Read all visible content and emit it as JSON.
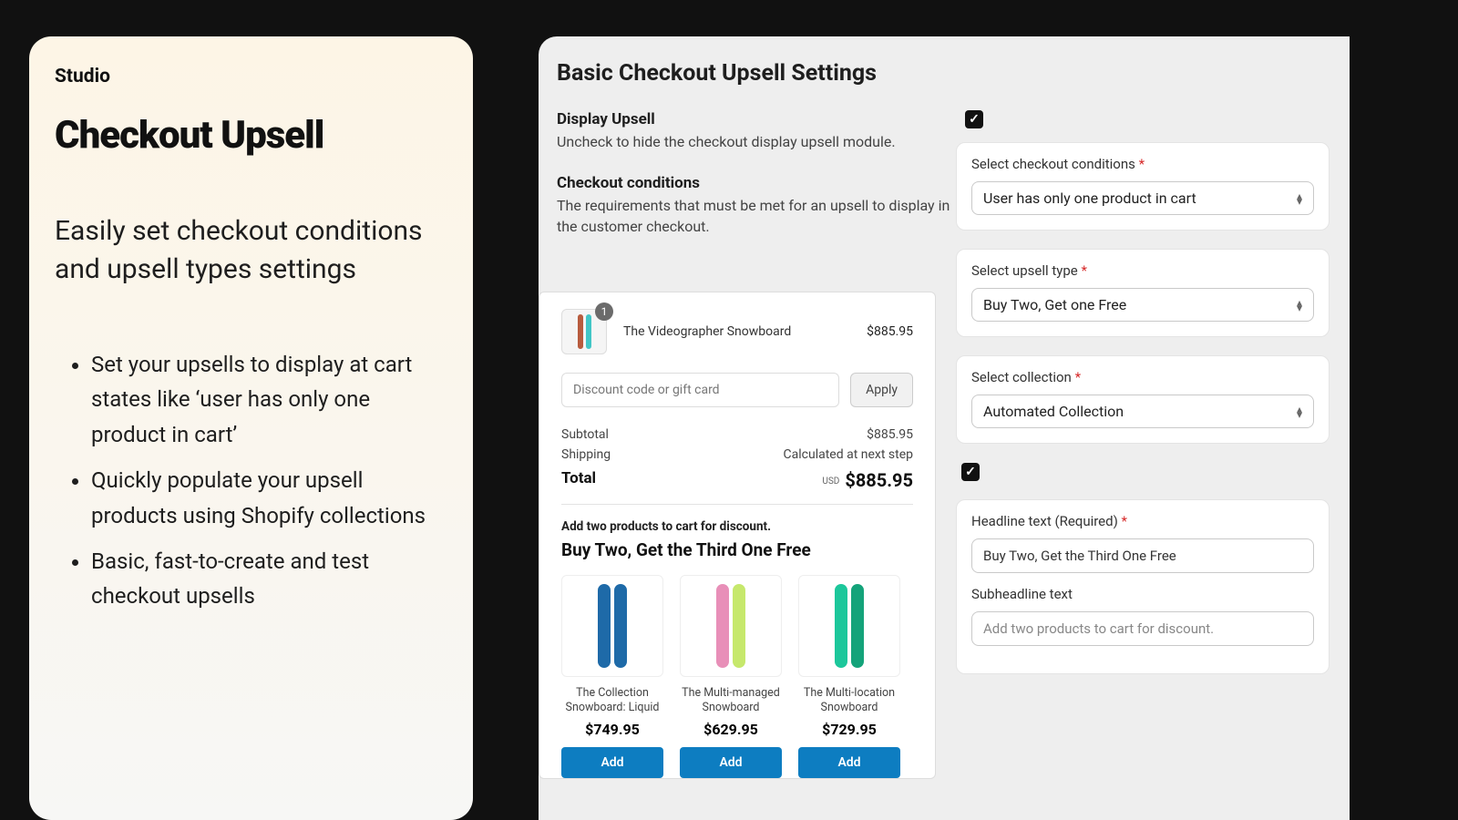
{
  "left": {
    "brand": "Studio",
    "title": "Checkout Upsell",
    "subtitle": "Easily set checkout conditions and upsell types settings",
    "bullets": [
      "Set your upsells to display at cart states like ‘user has only one product in cart’",
      "Quickly populate your upsell products using Shopify collections",
      "Basic, fast-to-create and test checkout upsells"
    ]
  },
  "settings": {
    "title": "Basic Checkout Upsell Settings",
    "display_upsell": {
      "label": "Display Upsell",
      "help": "Uncheck to hide the checkout display upsell module.",
      "checked": true
    },
    "checkout_conditions": {
      "label": "Checkout conditions",
      "help": "The requirements that must be met for an upsell to display in the customer checkout."
    },
    "fields": {
      "conditions": {
        "label": "Select checkout conditions",
        "value": "User has only one product in cart"
      },
      "upsell_type": {
        "label": "Select upsell type",
        "value": "Buy Two, Get one Free"
      },
      "collection": {
        "label": "Select collection",
        "value": "Automated Collection"
      },
      "extra_checked": true,
      "headline": {
        "label": "Headline text (Required)",
        "value": "Buy Two, Get the Third One Free"
      },
      "subheadline": {
        "label": "Subheadline text",
        "placeholder": "Add two products to cart for discount."
      }
    }
  },
  "preview": {
    "cart_item": {
      "name": "The Videographer Snowboard",
      "price": "$885.95",
      "qty": "1"
    },
    "discount_placeholder": "Discount code or gift card",
    "apply": "Apply",
    "subtotal": {
      "label": "Subtotal",
      "value": "$885.95"
    },
    "shipping": {
      "label": "Shipping",
      "value": "Calculated at next step"
    },
    "total": {
      "label": "Total",
      "currency": "USD",
      "value": "$885.95"
    },
    "promo_sub": "Add two products to cart for discount.",
    "promo_head": "Buy Two, Get the Third One Free",
    "products": [
      {
        "name": "The Collection Snowboard: Liquid",
        "price": "$749.95",
        "btn": "Add",
        "colors": [
          "#1e6aa8",
          "#1e6aa8"
        ]
      },
      {
        "name": "The Multi-managed Snowboard",
        "price": "$629.95",
        "btn": "Add",
        "colors": [
          "#e88fb8",
          "#c6e86c"
        ]
      },
      {
        "name": "The Multi-location Snowboard",
        "price": "$729.95",
        "btn": "Add",
        "colors": [
          "#1cc79b",
          "#14a37a"
        ]
      }
    ]
  }
}
